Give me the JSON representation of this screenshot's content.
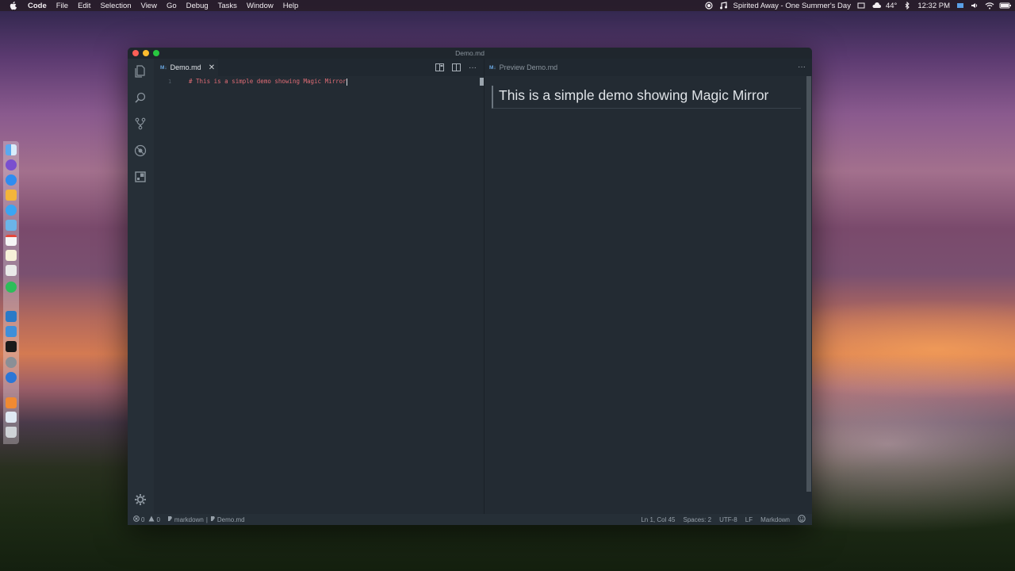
{
  "menubar": {
    "app_name": "Code",
    "items": [
      "File",
      "Edit",
      "Selection",
      "View",
      "Go",
      "Debug",
      "Tasks",
      "Window",
      "Help"
    ],
    "now_playing": "Spirited Away - One Summer's Day",
    "weather": "44°",
    "time": "12:32 PM"
  },
  "window": {
    "title": "Demo.md"
  },
  "editor": {
    "tab_icon": "M↓",
    "tab_label": "Demo.md",
    "line_number": "1",
    "line_text": "# This is a simple demo showing Magic Mirror"
  },
  "preview": {
    "tab_icon": "M↓",
    "tab_label": "Preview Demo.md",
    "heading": "This is a simple demo showing Magic Mirror"
  },
  "statusbar": {
    "errors": "0",
    "warnings": "0",
    "language_mode_left": "markdown",
    "file_name": "Demo.md",
    "cursor_position": "Ln 1, Col 45",
    "indentation": "Spaces: 2",
    "encoding": "UTF-8",
    "eol": "LF",
    "language": "Markdown"
  },
  "colors": {
    "editor_bg": "#232b33",
    "heading_token": "#e06c75",
    "markdown_icon": "#6aa7e0"
  }
}
